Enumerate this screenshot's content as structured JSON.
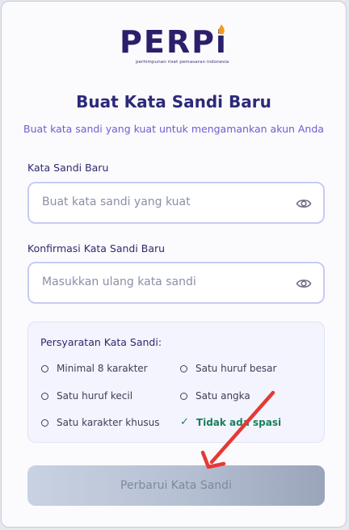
{
  "logo": {
    "text": "PERPi",
    "tagline": "perhimpunan riset pemasaran indonesia"
  },
  "header": {
    "title": "Buat Kata Sandi Baru",
    "subtitle": "Buat kata sandi yang kuat untuk mengamankan akun Anda"
  },
  "form": {
    "new_password": {
      "label": "Kata Sandi Baru",
      "placeholder": "Buat kata sandi yang kuat",
      "icon": "eye-icon"
    },
    "confirm_password": {
      "label": "Konfirmasi Kata Sandi Baru",
      "placeholder": "Masukkan ulang kata sandi",
      "icon": "eye-icon"
    }
  },
  "requirements": {
    "title": "Persyaratan Kata Sandi:",
    "items": [
      {
        "label": "Minimal 8 karakter",
        "met": false
      },
      {
        "label": "Satu huruf besar",
        "met": false
      },
      {
        "label": "Satu huruf kecil",
        "met": false
      },
      {
        "label": "Satu angka",
        "met": false
      },
      {
        "label": "Satu karakter khusus",
        "met": false
      },
      {
        "label": "Tidak ada spasi",
        "met": true
      }
    ]
  },
  "submit": {
    "label": "Perbarui Kata Sandi"
  },
  "colors": {
    "accent": "#2d2a7a",
    "success": "#1a7f5a",
    "annotation_arrow": "#e53935"
  }
}
